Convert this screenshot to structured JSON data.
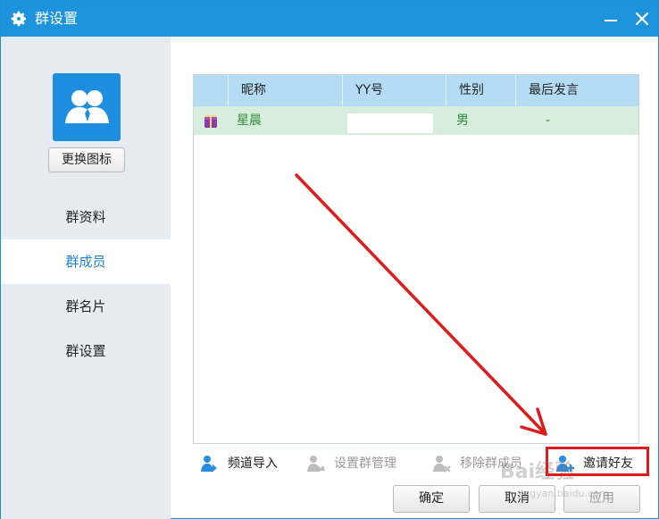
{
  "window": {
    "title": "群设置",
    "icons": {
      "title": "gear-icon",
      "minimize": "minimize-icon",
      "close": "close-icon"
    }
  },
  "sidebar": {
    "avatar_icon": "group-people-icon",
    "change_icon_label": "更换图标",
    "items": [
      {
        "label": "群资料",
        "active": false
      },
      {
        "label": "群成员",
        "active": true
      },
      {
        "label": "群名片",
        "active": false
      },
      {
        "label": "群设置",
        "active": false
      }
    ]
  },
  "members": {
    "columns": [
      "昵称",
      "YY号",
      "性别",
      "最后发言"
    ],
    "rows": [
      {
        "role_icon": "owner-crown-icon",
        "nickname": "星晨",
        "yy_number": "",
        "gender": "男",
        "last_message": "-"
      }
    ]
  },
  "actions": [
    {
      "label": "频道导入",
      "icon": "import-users-icon",
      "enabled": true
    },
    {
      "label": "设置群管理",
      "icon": "set-admin-icon",
      "enabled": false
    },
    {
      "label": "移除群成员",
      "icon": "remove-member-icon",
      "enabled": false
    },
    {
      "label": "邀请好友",
      "icon": "invite-friend-icon",
      "enabled": true
    }
  ],
  "buttons": {
    "confirm": "确定",
    "cancel": "取消",
    "apply": "应用",
    "apply_enabled": false
  },
  "colors": {
    "titlebar": "#1e93dd",
    "sidebar_bg": "#e6ecf1",
    "active_nav_text": "#1e7fd0",
    "table_header": "#b4dcf5",
    "selected_row": "#d6eedb",
    "annotation_red": "#e01b1b"
  },
  "annotation": {
    "type": "red arrow pointing to highlighted invite-friend button",
    "watermark": "Bai经验",
    "watermark_sub": "jingyan.baidu.com"
  }
}
